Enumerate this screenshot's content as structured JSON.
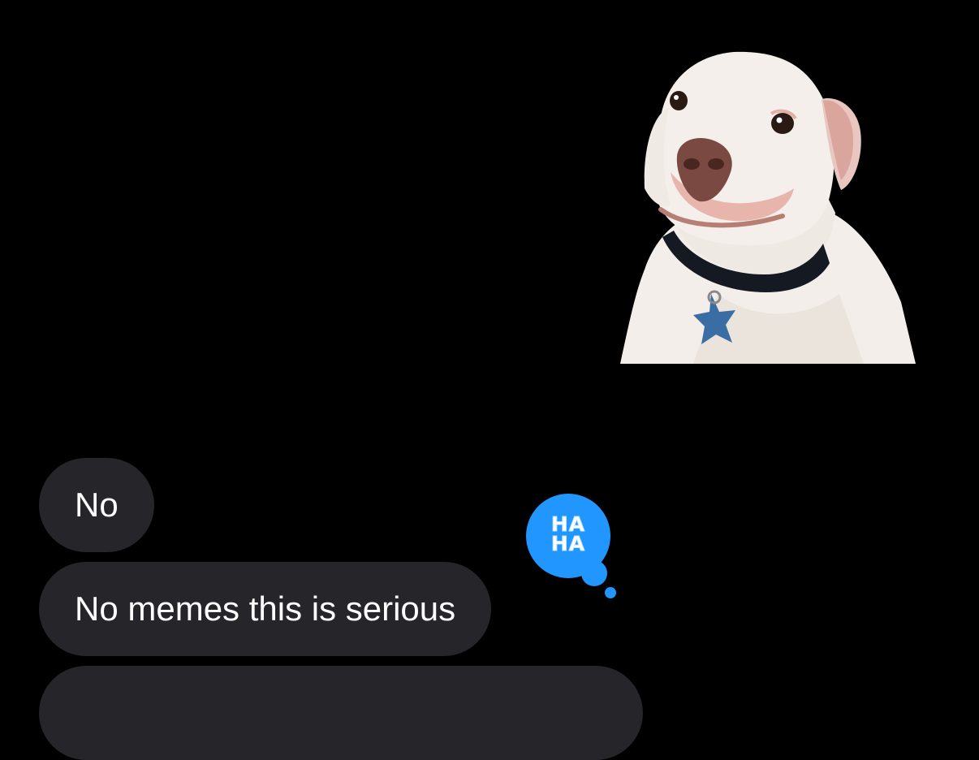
{
  "conversation": {
    "sticker": {
      "icon": "dog-sticker-icon",
      "description_visible": false
    },
    "messages": [
      {
        "sender": "other",
        "text": "No"
      },
      {
        "sender": "other",
        "text": "No memes this is serious"
      },
      {
        "sender": "other",
        "text": ""
      }
    ],
    "tapback": {
      "target_message": 1,
      "line1": "HA",
      "line2": "HA",
      "icon": "haha-tapback-icon",
      "color": "#2196ff"
    }
  },
  "colors": {
    "background": "#000000",
    "incoming_bubble": "#26252a",
    "incoming_text": "#ffffff",
    "tapback_blue": "#2196ff"
  }
}
